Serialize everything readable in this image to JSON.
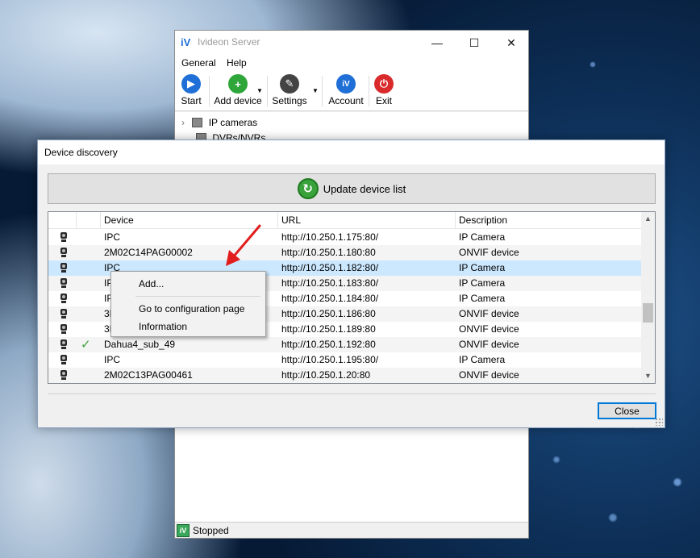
{
  "main_window": {
    "logo": "iV",
    "title": "Ivideon Server",
    "controls": {
      "minimize": "—",
      "maximize": "☐",
      "close": "✕"
    },
    "menu": [
      "General",
      "Help"
    ],
    "toolbar": [
      {
        "label": "Start",
        "glyph": "▶",
        "color": "#1f6fd6"
      },
      {
        "label": "Add device",
        "glyph": "+",
        "color": "#2ea63a"
      },
      {
        "label": "Settings",
        "glyph": "✎",
        "color": "#444444"
      },
      {
        "label": "Account",
        "glyph": "iV",
        "color": "#1f6fd6"
      },
      {
        "label": "Exit",
        "glyph": "⏻",
        "color": "#d92b2b"
      }
    ],
    "tree": [
      "IP cameras",
      "DVRs/NVRs"
    ],
    "status": {
      "icon": "iV",
      "text": "Stopped"
    }
  },
  "dialog": {
    "title": "Device discovery",
    "update_button": "Update device list",
    "columns": [
      "Device",
      "URL",
      "Description"
    ],
    "rows": [
      {
        "device": "IPC",
        "url": "http://10.250.1.175:80/",
        "description": "IP Camera",
        "added": false
      },
      {
        "device": "2M02C14PAG00002",
        "url": "http://10.250.1.180:80",
        "description": "ONVIF device",
        "added": false
      },
      {
        "device": "IPC",
        "url": "http://10.250.1.182:80/",
        "description": "IP Camera",
        "added": false,
        "selected": true
      },
      {
        "device": "IPC",
        "url": "http://10.250.1.183:80/",
        "description": "IP Camera",
        "added": false
      },
      {
        "device": "IPC",
        "url": "http://10.250.1.184:80/",
        "description": "IP Camera",
        "added": false
      },
      {
        "device": "3D",
        "url": "http://10.250.1.186:80",
        "description": "ONVIF device",
        "added": false
      },
      {
        "device": "3D",
        "url": "http://10.250.1.189:80",
        "description": "ONVIF device",
        "added": false
      },
      {
        "device": "Dahua4_sub_49",
        "url": "http://10.250.1.192:80",
        "description": "ONVIF device",
        "added": true
      },
      {
        "device": "IPC",
        "url": "http://10.250.1.195:80/",
        "description": "IP Camera",
        "added": false
      },
      {
        "device": "2M02C13PAG00461",
        "url": "http://10.250.1.20:80",
        "description": "ONVIF device",
        "added": false
      }
    ],
    "close_button": "Close"
  },
  "context_menu": {
    "items": [
      "Add...",
      "Go to configuration page",
      "Information"
    ]
  }
}
